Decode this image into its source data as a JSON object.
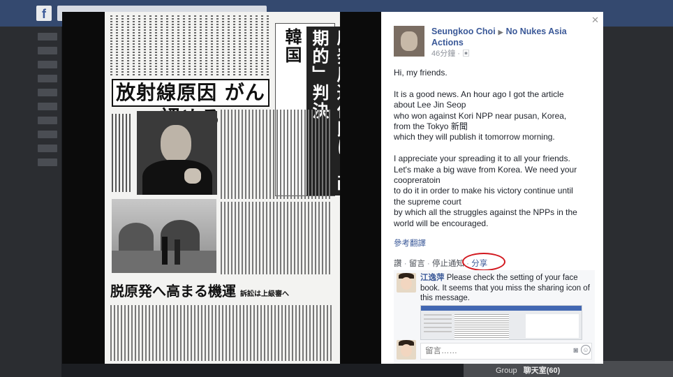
{
  "post": {
    "author": "Seungkoo Choi",
    "target": "No Nukes Asia Actions",
    "time": "46分鐘",
    "paragraphs": [
      "Hi, my friends.",
      "It is a good news. An hour ago I got the article\nabout Lee Jin Seop\nwho won against Kori NPP near pusan, Korea,\nfrom the Tokyo 新聞\nwhich they will publish it tomorrow morning.",
      "I appreciate your spreading it to all your friends.\nLet's make a big wave from Korea. We need your\ncoopreratoin\nto do it in order to  make his victory continue until\nthe supreme court\nby which all the struggles against the NPPs in the\nworld will be encouraged."
    ],
    "translate_label": "參考翻譯",
    "actions": {
      "like": "讚",
      "comment": "留言",
      "stop_notify": "停止通知",
      "share": "分享"
    }
  },
  "comment": {
    "author": "江逸萍",
    "text": "Please check the setting of your face book. It seems that you miss the sharing icon of this message.",
    "input_placeholder": "留言……"
  },
  "newspaper": {
    "headline_1": "韓国",
    "headline_2": "原発周辺住民に「画期的」判決",
    "headline_main": "放射線原因 がん認める",
    "headline_bottom": "脱原発へ高まる機運",
    "headline_bottom_sub": "訴訟は上級審へ"
  },
  "background": {
    "bottom_label": "Group",
    "chat_label": "聊天室(60)"
  },
  "colors": {
    "link": "#3b5998",
    "highlight_ring": "#d2171e"
  }
}
